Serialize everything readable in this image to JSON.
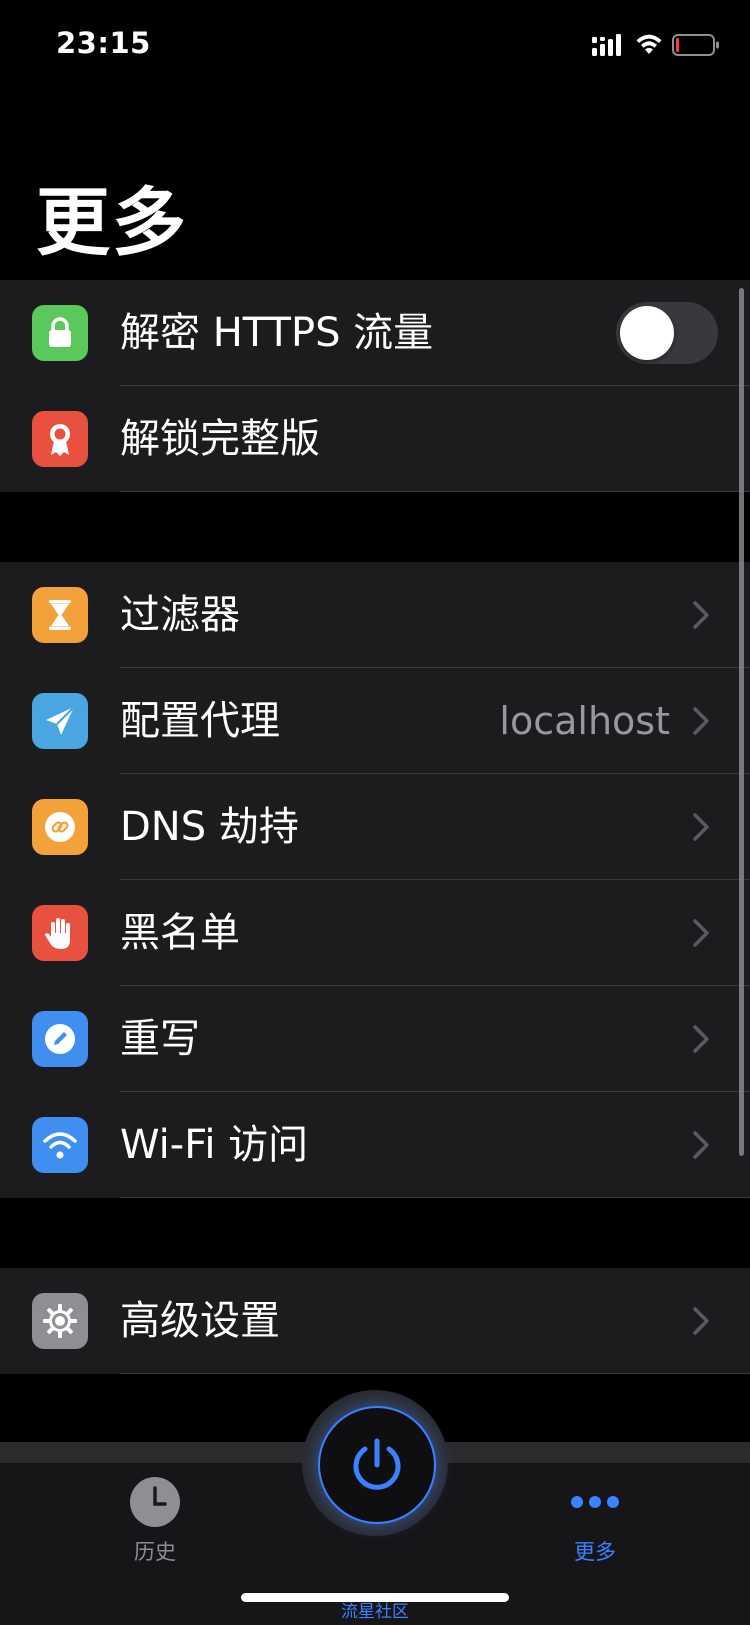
{
  "status_bar": {
    "time": "23:15"
  },
  "page": {
    "title": "更多"
  },
  "sections": [
    {
      "rows": [
        {
          "label": "解密 HTTPS 流量",
          "icon": "lock-icon",
          "icon_color": "#5ac85a",
          "toggle_on": false
        },
        {
          "label": "解锁完整版",
          "icon": "award-ribbon-icon",
          "icon_color": "#e8503f"
        }
      ]
    },
    {
      "rows": [
        {
          "label": "过滤器",
          "icon": "hourglass-icon",
          "icon_color": "#f3a23a"
        },
        {
          "label": "配置代理",
          "value": "localhost",
          "icon": "paper-plane-icon",
          "icon_color": "#4aa6e0"
        },
        {
          "label": "DNS 劫持",
          "icon": "link-icon",
          "icon_color": "#f3a23a"
        },
        {
          "label": "黑名单",
          "icon": "hand-stop-icon",
          "icon_color": "#e8503f"
        },
        {
          "label": "重写",
          "icon": "pencil-icon",
          "icon_color": "#3f8ef0"
        },
        {
          "label": "Wi-Fi 访问",
          "icon": "wifi-icon",
          "icon_color": "#3f8ef0"
        }
      ]
    },
    {
      "rows": [
        {
          "label": "高级设置",
          "icon": "gear-icon",
          "icon_color": "#8e8e93"
        }
      ]
    }
  ],
  "tab_bar": {
    "history_label": "历史",
    "more_label": "更多",
    "active_color": "#3a82ff",
    "community_label": "流星社区"
  }
}
